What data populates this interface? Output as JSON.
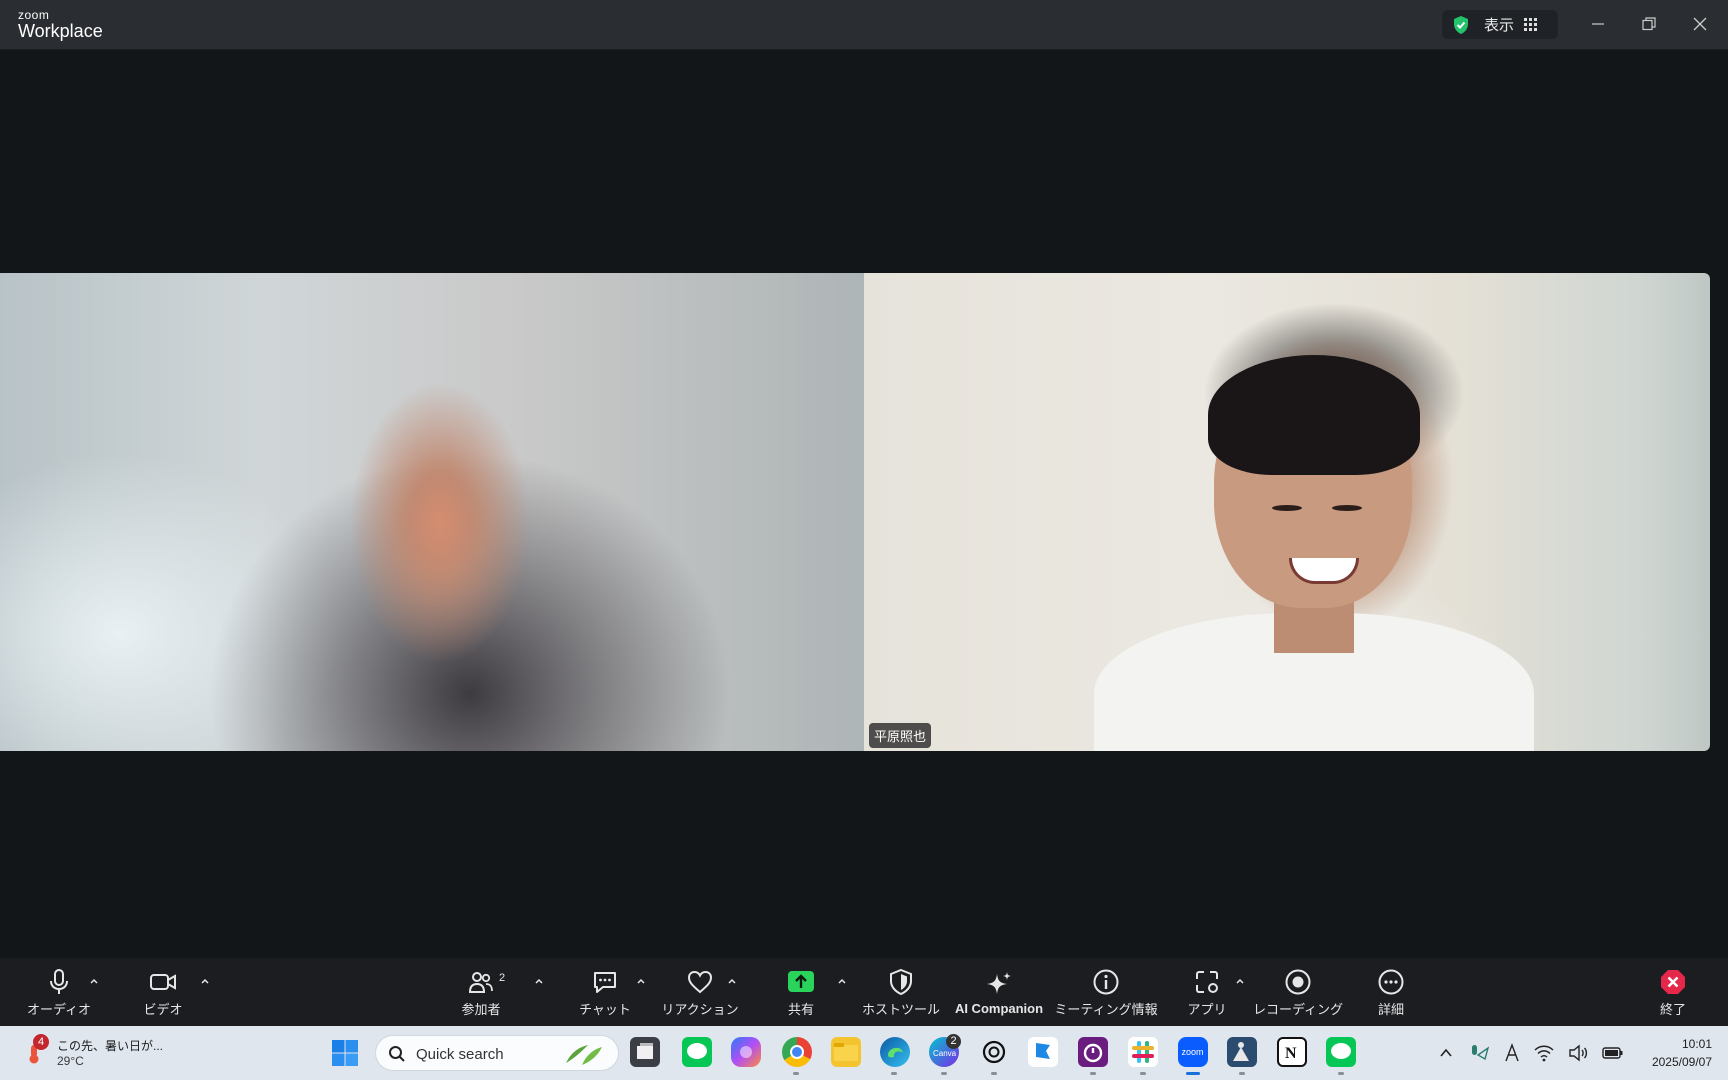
{
  "titlebar": {
    "logo_small": "zoom",
    "logo_big": "Workplace",
    "view_label": "表示"
  },
  "video": {
    "participant_name": "平原照也"
  },
  "toolbar": {
    "audio": "オーディオ",
    "video": "ビデオ",
    "participants": "参加者",
    "participants_count": "2",
    "chat": "チャット",
    "reactions": "リアクション",
    "share": "共有",
    "host_tools": "ホストツール",
    "ai_companion": "AI Companion",
    "meeting_info": "ミーティング情報",
    "apps": "アプリ",
    "recording": "レコーディング",
    "more": "詳細",
    "end": "終了",
    "share_color": "#2ad45b",
    "end_color": "#e5274a"
  },
  "taskbar": {
    "weather_badge": "4",
    "weather_text": "この先、暑い日が...",
    "temperature": "29°C",
    "search_placeholder": "Quick search",
    "canva_badge": "2",
    "time": "10:01",
    "date": "2025/09/07"
  }
}
